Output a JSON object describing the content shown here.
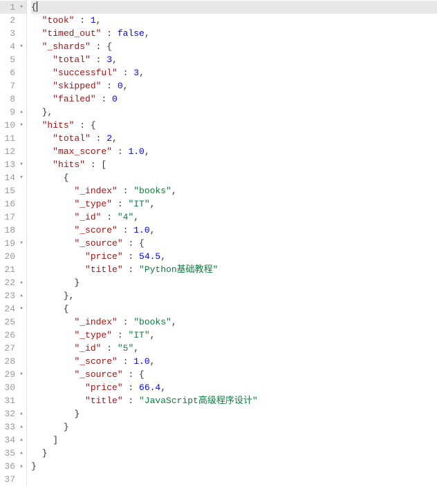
{
  "lines": [
    {
      "no": 1,
      "fold": "▾",
      "active": true,
      "segs": [
        {
          "t": "{",
          "c": "p"
        }
      ],
      "cursor_after": 0
    },
    {
      "no": 2,
      "fold": "",
      "segs": [
        {
          "t": "  ",
          "c": "p"
        },
        {
          "t": "\"took\"",
          "c": "k"
        },
        {
          "t": " : ",
          "c": "p"
        },
        {
          "t": "1",
          "c": "n"
        },
        {
          "t": ",",
          "c": "p"
        }
      ]
    },
    {
      "no": 3,
      "fold": "",
      "segs": [
        {
          "t": "  ",
          "c": "p"
        },
        {
          "t": "\"timed_out\"",
          "c": "k"
        },
        {
          "t": " : ",
          "c": "p"
        },
        {
          "t": "false",
          "c": "b"
        },
        {
          "t": ",",
          "c": "p"
        }
      ]
    },
    {
      "no": 4,
      "fold": "▾",
      "segs": [
        {
          "t": "  ",
          "c": "p"
        },
        {
          "t": "\"_shards\"",
          "c": "k"
        },
        {
          "t": " : {",
          "c": "p"
        }
      ]
    },
    {
      "no": 5,
      "fold": "",
      "segs": [
        {
          "t": "    ",
          "c": "p"
        },
        {
          "t": "\"total\"",
          "c": "k"
        },
        {
          "t": " : ",
          "c": "p"
        },
        {
          "t": "3",
          "c": "n"
        },
        {
          "t": ",",
          "c": "p"
        }
      ]
    },
    {
      "no": 6,
      "fold": "",
      "segs": [
        {
          "t": "    ",
          "c": "p"
        },
        {
          "t": "\"successful\"",
          "c": "k"
        },
        {
          "t": " : ",
          "c": "p"
        },
        {
          "t": "3",
          "c": "n"
        },
        {
          "t": ",",
          "c": "p"
        }
      ]
    },
    {
      "no": 7,
      "fold": "",
      "segs": [
        {
          "t": "    ",
          "c": "p"
        },
        {
          "t": "\"skipped\"",
          "c": "k"
        },
        {
          "t": " : ",
          "c": "p"
        },
        {
          "t": "0",
          "c": "n"
        },
        {
          "t": ",",
          "c": "p"
        }
      ]
    },
    {
      "no": 8,
      "fold": "",
      "segs": [
        {
          "t": "    ",
          "c": "p"
        },
        {
          "t": "\"failed\"",
          "c": "k"
        },
        {
          "t": " : ",
          "c": "p"
        },
        {
          "t": "0",
          "c": "n"
        }
      ]
    },
    {
      "no": 9,
      "fold": "▴",
      "segs": [
        {
          "t": "  },",
          "c": "p"
        }
      ]
    },
    {
      "no": 10,
      "fold": "▾",
      "segs": [
        {
          "t": "  ",
          "c": "p"
        },
        {
          "t": "\"hits\"",
          "c": "k"
        },
        {
          "t": " : {",
          "c": "p"
        }
      ]
    },
    {
      "no": 11,
      "fold": "",
      "segs": [
        {
          "t": "    ",
          "c": "p"
        },
        {
          "t": "\"total\"",
          "c": "k"
        },
        {
          "t": " : ",
          "c": "p"
        },
        {
          "t": "2",
          "c": "n"
        },
        {
          "t": ",",
          "c": "p"
        }
      ]
    },
    {
      "no": 12,
      "fold": "",
      "segs": [
        {
          "t": "    ",
          "c": "p"
        },
        {
          "t": "\"max_score\"",
          "c": "k"
        },
        {
          "t": " : ",
          "c": "p"
        },
        {
          "t": "1.0",
          "c": "n"
        },
        {
          "t": ",",
          "c": "p"
        }
      ]
    },
    {
      "no": 13,
      "fold": "▾",
      "segs": [
        {
          "t": "    ",
          "c": "p"
        },
        {
          "t": "\"hits\"",
          "c": "k"
        },
        {
          "t": " : [",
          "c": "p"
        }
      ]
    },
    {
      "no": 14,
      "fold": "▾",
      "segs": [
        {
          "t": "      {",
          "c": "p"
        }
      ]
    },
    {
      "no": 15,
      "fold": "",
      "segs": [
        {
          "t": "        ",
          "c": "p"
        },
        {
          "t": "\"_index\"",
          "c": "k"
        },
        {
          "t": " : ",
          "c": "p"
        },
        {
          "t": "\"books\"",
          "c": "s"
        },
        {
          "t": ",",
          "c": "p"
        }
      ]
    },
    {
      "no": 16,
      "fold": "",
      "segs": [
        {
          "t": "        ",
          "c": "p"
        },
        {
          "t": "\"_type\"",
          "c": "k"
        },
        {
          "t": " : ",
          "c": "p"
        },
        {
          "t": "\"IT\"",
          "c": "s"
        },
        {
          "t": ",",
          "c": "p"
        }
      ]
    },
    {
      "no": 17,
      "fold": "",
      "segs": [
        {
          "t": "        ",
          "c": "p"
        },
        {
          "t": "\"_id\"",
          "c": "k"
        },
        {
          "t": " : ",
          "c": "p"
        },
        {
          "t": "\"4\"",
          "c": "s"
        },
        {
          "t": ",",
          "c": "p"
        }
      ]
    },
    {
      "no": 18,
      "fold": "",
      "segs": [
        {
          "t": "        ",
          "c": "p"
        },
        {
          "t": "\"_score\"",
          "c": "k"
        },
        {
          "t": " : ",
          "c": "p"
        },
        {
          "t": "1.0",
          "c": "n"
        },
        {
          "t": ",",
          "c": "p"
        }
      ]
    },
    {
      "no": 19,
      "fold": "▾",
      "segs": [
        {
          "t": "        ",
          "c": "p"
        },
        {
          "t": "\"_source\"",
          "c": "k"
        },
        {
          "t": " : {",
          "c": "p"
        }
      ]
    },
    {
      "no": 20,
      "fold": "",
      "segs": [
        {
          "t": "          ",
          "c": "p"
        },
        {
          "t": "\"price\"",
          "c": "k"
        },
        {
          "t": " : ",
          "c": "p"
        },
        {
          "t": "54.5",
          "c": "n"
        },
        {
          "t": ",",
          "c": "p"
        }
      ]
    },
    {
      "no": 21,
      "fold": "",
      "segs": [
        {
          "t": "          ",
          "c": "p"
        },
        {
          "t": "\"title\"",
          "c": "k"
        },
        {
          "t": " : ",
          "c": "p"
        },
        {
          "t": "\"Python基础教程\"",
          "c": "s"
        }
      ]
    },
    {
      "no": 22,
      "fold": "▴",
      "segs": [
        {
          "t": "        }",
          "c": "p"
        }
      ]
    },
    {
      "no": 23,
      "fold": "▴",
      "segs": [
        {
          "t": "      },",
          "c": "p"
        }
      ]
    },
    {
      "no": 24,
      "fold": "▾",
      "segs": [
        {
          "t": "      {",
          "c": "p"
        }
      ]
    },
    {
      "no": 25,
      "fold": "",
      "segs": [
        {
          "t": "        ",
          "c": "p"
        },
        {
          "t": "\"_index\"",
          "c": "k"
        },
        {
          "t": " : ",
          "c": "p"
        },
        {
          "t": "\"books\"",
          "c": "s"
        },
        {
          "t": ",",
          "c": "p"
        }
      ]
    },
    {
      "no": 26,
      "fold": "",
      "segs": [
        {
          "t": "        ",
          "c": "p"
        },
        {
          "t": "\"_type\"",
          "c": "k"
        },
        {
          "t": " : ",
          "c": "p"
        },
        {
          "t": "\"IT\"",
          "c": "s"
        },
        {
          "t": ",",
          "c": "p"
        }
      ]
    },
    {
      "no": 27,
      "fold": "",
      "segs": [
        {
          "t": "        ",
          "c": "p"
        },
        {
          "t": "\"_id\"",
          "c": "k"
        },
        {
          "t": " : ",
          "c": "p"
        },
        {
          "t": "\"5\"",
          "c": "s"
        },
        {
          "t": ",",
          "c": "p"
        }
      ]
    },
    {
      "no": 28,
      "fold": "",
      "segs": [
        {
          "t": "        ",
          "c": "p"
        },
        {
          "t": "\"_score\"",
          "c": "k"
        },
        {
          "t": " : ",
          "c": "p"
        },
        {
          "t": "1.0",
          "c": "n"
        },
        {
          "t": ",",
          "c": "p"
        }
      ]
    },
    {
      "no": 29,
      "fold": "▾",
      "segs": [
        {
          "t": "        ",
          "c": "p"
        },
        {
          "t": "\"_source\"",
          "c": "k"
        },
        {
          "t": " : {",
          "c": "p"
        }
      ]
    },
    {
      "no": 30,
      "fold": "",
      "segs": [
        {
          "t": "          ",
          "c": "p"
        },
        {
          "t": "\"price\"",
          "c": "k"
        },
        {
          "t": " : ",
          "c": "p"
        },
        {
          "t": "66.4",
          "c": "n"
        },
        {
          "t": ",",
          "c": "p"
        }
      ]
    },
    {
      "no": 31,
      "fold": "",
      "segs": [
        {
          "t": "          ",
          "c": "p"
        },
        {
          "t": "\"title\"",
          "c": "k"
        },
        {
          "t": " : ",
          "c": "p"
        },
        {
          "t": "\"JavaScript高级程序设计\"",
          "c": "s"
        }
      ]
    },
    {
      "no": 32,
      "fold": "▴",
      "segs": [
        {
          "t": "        }",
          "c": "p"
        }
      ]
    },
    {
      "no": 33,
      "fold": "▴",
      "segs": [
        {
          "t": "      }",
          "c": "p"
        }
      ]
    },
    {
      "no": 34,
      "fold": "▴",
      "segs": [
        {
          "t": "    ]",
          "c": "p"
        }
      ]
    },
    {
      "no": 35,
      "fold": "▴",
      "segs": [
        {
          "t": "  }",
          "c": "p"
        }
      ]
    },
    {
      "no": 36,
      "fold": "▴",
      "segs": [
        {
          "t": "}",
          "c": "p"
        }
      ]
    },
    {
      "no": 37,
      "fold": "",
      "segs": [
        {
          "t": "",
          "c": "p"
        }
      ]
    }
  ]
}
